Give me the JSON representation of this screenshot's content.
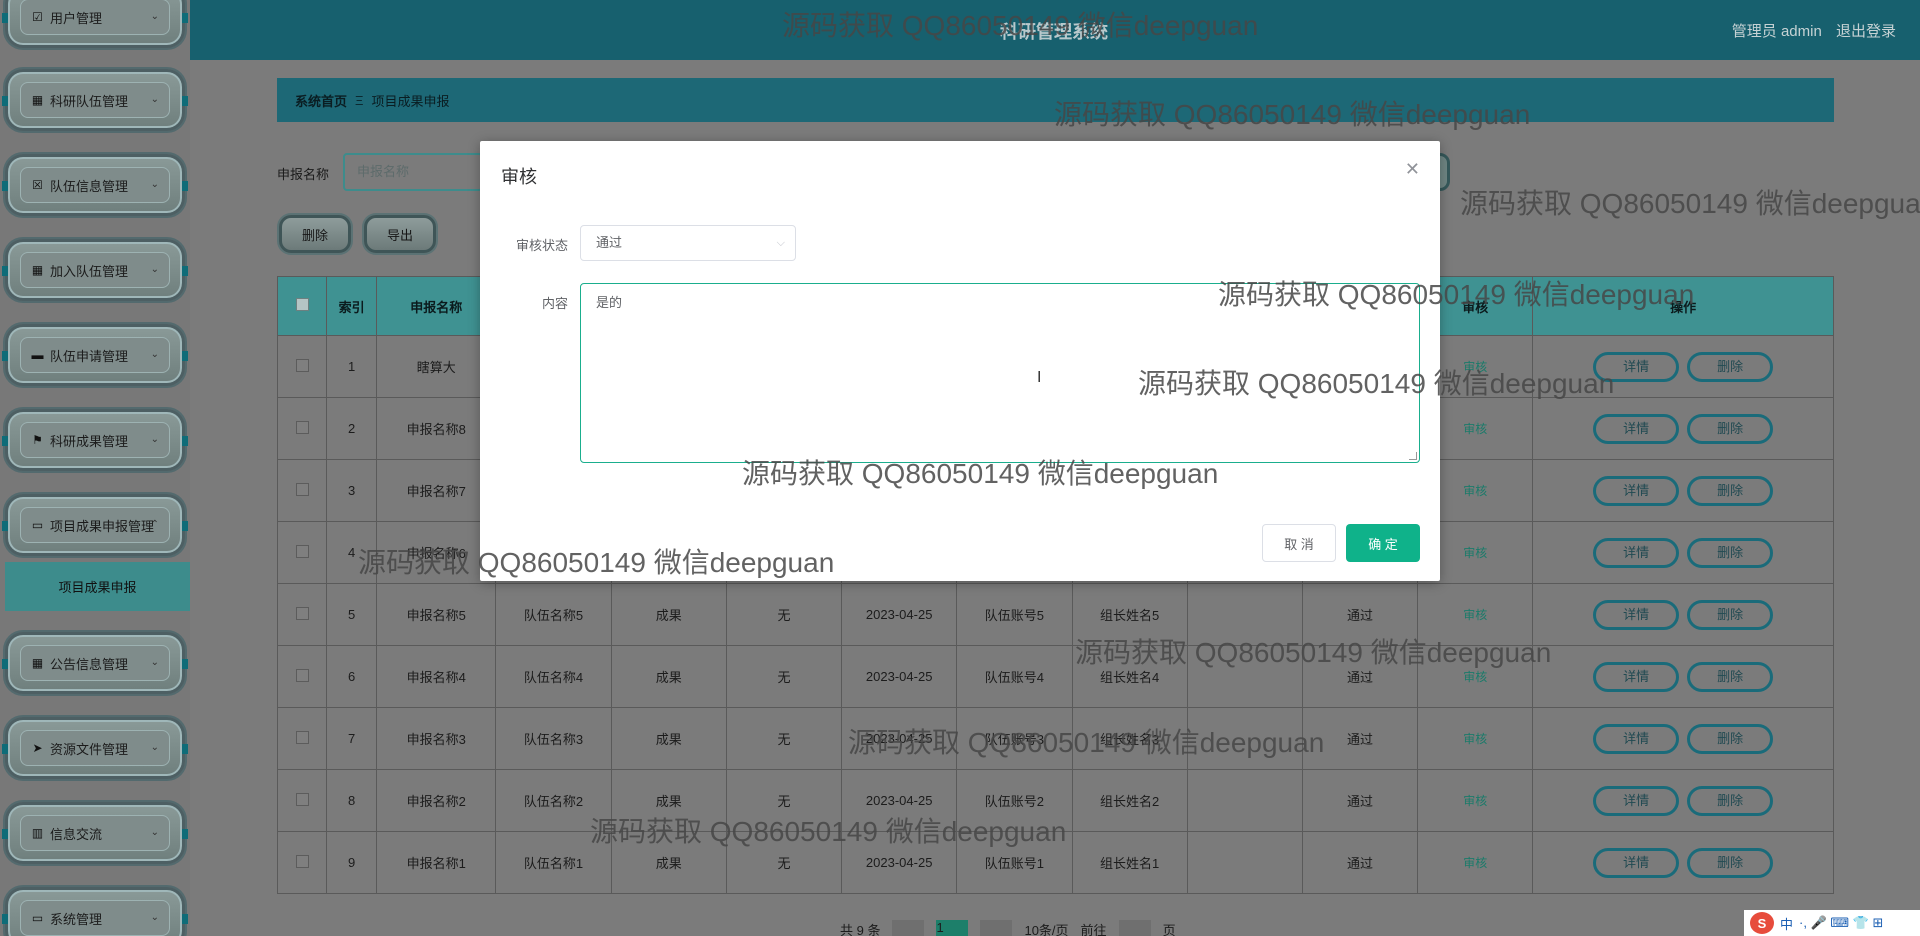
{
  "header": {
    "title": "科研管理系统",
    "user_label": "管理员 admin",
    "logout_label": "退出登录"
  },
  "sidebar": {
    "items": [
      {
        "label": "用户管理",
        "icon": "checkbox-icon"
      },
      {
        "label": "科研队伍管理",
        "icon": "grid-icon"
      },
      {
        "label": "队伍信息管理",
        "icon": "cross-box-icon"
      },
      {
        "label": "加入队伍管理",
        "icon": "grid-icon"
      },
      {
        "label": "队伍申请管理",
        "icon": "printer-icon"
      },
      {
        "label": "科研成果管理",
        "icon": "flag-icon"
      },
      {
        "label": "项目成果申报管理",
        "icon": "monitor-icon"
      },
      {
        "label": "公告信息管理",
        "icon": "grid-icon"
      },
      {
        "label": "资源文件管理",
        "icon": "send-icon"
      },
      {
        "label": "信息交流",
        "icon": "chart-icon"
      },
      {
        "label": "系统管理",
        "icon": "monitor-icon"
      }
    ],
    "active_sub": "项目成果申报"
  },
  "breadcrumb": {
    "home": "系统首页",
    "sep": "Ξ",
    "current": "项目成果申报"
  },
  "search": {
    "label": "申报名称",
    "placeholder": "申报名称"
  },
  "toolbar": {
    "delete_label": "删除",
    "export_label": "导出"
  },
  "table": {
    "headers": [
      "索引",
      "申报名称",
      "",
      "",
      "",
      "",
      "",
      "",
      "",
      "",
      "审核",
      "操作"
    ],
    "detail_label": "详情",
    "delete_label": "删除",
    "audit_label": "审核",
    "rows": [
      {
        "idx": "1",
        "name": "瞎算大",
        "team": "",
        "type": "",
        "remark": "",
        "date": "",
        "acct": "",
        "leader": "",
        "status": ""
      },
      {
        "idx": "2",
        "name": "申报名称8",
        "team": "",
        "type": "",
        "remark": "",
        "date": "",
        "acct": "",
        "leader": "",
        "status": ""
      },
      {
        "idx": "3",
        "name": "申报名称7",
        "team": "",
        "type": "",
        "remark": "",
        "date": "",
        "acct": "",
        "leader": "",
        "status": ""
      },
      {
        "idx": "4",
        "name": "申报名称6",
        "team": "",
        "type": "",
        "remark": "",
        "date": "",
        "acct": "",
        "leader": "",
        "status": ""
      },
      {
        "idx": "5",
        "name": "申报名称5",
        "team": "队伍名称5",
        "type": "成果",
        "remark": "无",
        "date": "2023-04-25",
        "acct": "队伍账号5",
        "leader": "组长姓名5",
        "status": "通过"
      },
      {
        "idx": "6",
        "name": "申报名称4",
        "team": "队伍名称4",
        "type": "成果",
        "remark": "无",
        "date": "2023-04-25",
        "acct": "队伍账号4",
        "leader": "组长姓名4",
        "status": "通过"
      },
      {
        "idx": "7",
        "name": "申报名称3",
        "team": "队伍名称3",
        "type": "成果",
        "remark": "无",
        "date": "2023-04-25",
        "acct": "队伍账号3",
        "leader": "组长姓名3",
        "status": "通过"
      },
      {
        "idx": "8",
        "name": "申报名称2",
        "team": "队伍名称2",
        "type": "成果",
        "remark": "无",
        "date": "2023-04-25",
        "acct": "队伍账号2",
        "leader": "组长姓名2",
        "status": "通过"
      },
      {
        "idx": "9",
        "name": "申报名称1",
        "team": "队伍名称1",
        "type": "成果",
        "remark": "无",
        "date": "2023-04-25",
        "acct": "队伍账号1",
        "leader": "组长姓名1",
        "status": "通过"
      }
    ]
  },
  "pager": {
    "total_text": "共 9 条",
    "page": "1",
    "size_text": "10条/页",
    "goto_text": "前往",
    "page_unit": "页"
  },
  "modal": {
    "title": "审核",
    "status_label": "审核状态",
    "status_value": "通过",
    "content_label": "内容",
    "content_value": "是的",
    "cancel_label": "取 消",
    "ok_label": "确 定"
  },
  "watermark": "源码获取 QQ86050149 微信deepguan",
  "tray": {
    "ime": "中",
    "items": "·, 🎤 ⌨ 👕 ⊞"
  }
}
